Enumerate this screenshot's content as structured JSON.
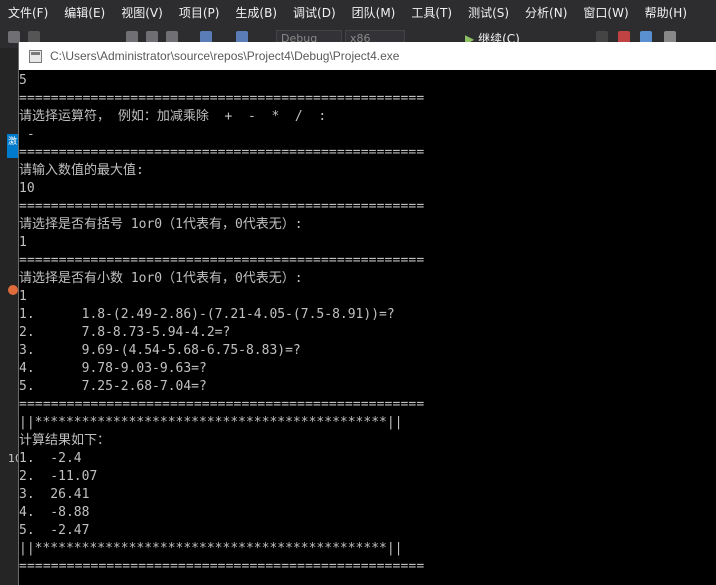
{
  "menubar": {
    "items": [
      "文件(F)",
      "编辑(E)",
      "视图(V)",
      "项目(P)",
      "生成(B)",
      "调试(D)",
      "团队(M)",
      "工具(T)",
      "测试(S)",
      "分析(N)",
      "窗口(W)",
      "帮助(H)"
    ]
  },
  "toolbar": {
    "config": "Debug",
    "platform": "x86",
    "continue_label": "继续(C)"
  },
  "left_strip": {
    "tab_glyph": "激",
    "line_number": "10"
  },
  "console": {
    "title": "C:\\Users\\Administrator\\source\\repos\\Project4\\Debug\\Project4.exe",
    "lines": [
      "5",
      "===================================================",
      "请选择运算符， 例如：加减乘除  +  -  *  /  :",
      " -",
      "===================================================",
      "请输入数值的最大值:",
      "10",
      "===================================================",
      "请选择是否有括号 1or0（1代表有，0代表无）:",
      "1",
      "===================================================",
      "请选择是否有小数 1or0（1代表有，0代表无）:",
      "1",
      "1.      1.8-(2.49-2.86)-(7.21-4.05-(7.5-8.91))=?",
      "2.      7.8-8.73-5.94-4.2=?",
      "3.      9.69-(4.54-5.68-6.75-8.83)=?",
      "4.      9.78-9.03-9.63=?",
      "5.      7.25-2.68-7.04=?",
      "===================================================",
      "||*********************************************||",
      "计算结果如下：",
      "1.  -2.4",
      "2.  -11.07",
      "3.  26.41",
      "4.  -8.88",
      "5.  -2.47",
      "||*********************************************||",
      "==================================================="
    ]
  }
}
